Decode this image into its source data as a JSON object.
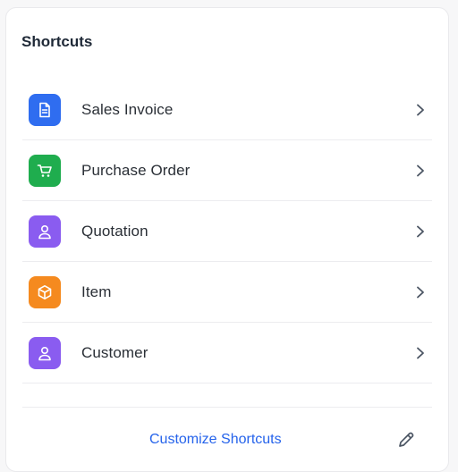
{
  "panel": {
    "title": "Shortcuts"
  },
  "shortcuts": [
    {
      "label": "Sales Invoice",
      "icon": "invoice-icon",
      "color": "#2f6df0"
    },
    {
      "label": "Purchase Order",
      "icon": "cart-icon",
      "color": "#1fad4e"
    },
    {
      "label": "Quotation",
      "icon": "user-icon",
      "color": "#8a5cf0"
    },
    {
      "label": "Item",
      "icon": "box-icon",
      "color": "#f58a1f"
    },
    {
      "label": "Customer",
      "icon": "user-icon",
      "color": "#8a5cf0"
    }
  ],
  "footer": {
    "customize_label": "Customize Shortcuts",
    "edit_icon": "pencil-icon",
    "link_color": "#2563eb"
  }
}
